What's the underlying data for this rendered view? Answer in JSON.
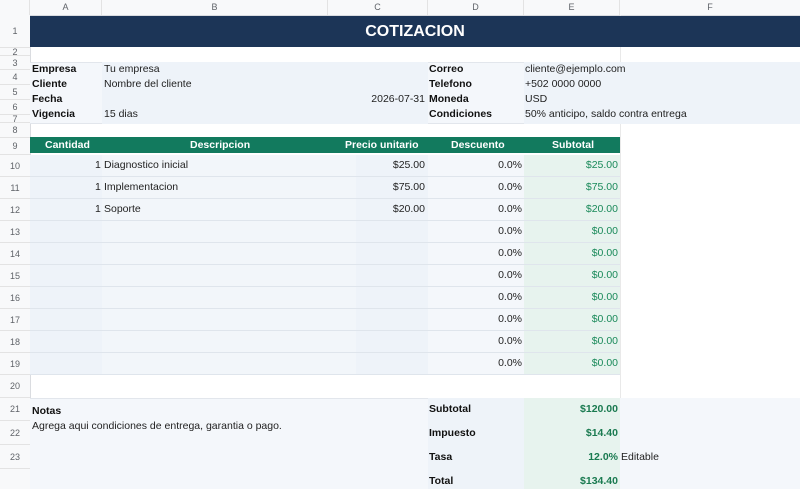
{
  "columns": [
    "A",
    "B",
    "C",
    "D",
    "E",
    "F"
  ],
  "rows": [
    "1",
    "2",
    "3",
    "4",
    "5",
    "6",
    "7",
    "8",
    "9",
    "10",
    "11",
    "12",
    "13",
    "14",
    "15",
    "16",
    "17",
    "18",
    "19",
    "20",
    "21",
    "22",
    "23"
  ],
  "title": "COTIZACION",
  "info_left": [
    {
      "label": "Empresa",
      "value": "Tu empresa"
    },
    {
      "label": "Cliente",
      "value": "Nombre del cliente"
    },
    {
      "label": "Fecha",
      "value": "",
      "extra": "2026-07-31"
    },
    {
      "label": "Vigencia",
      "value": "15 dias"
    }
  ],
  "info_right": [
    {
      "label": "Correo",
      "value": "cliente@ejemplo.com"
    },
    {
      "label": "Telefono",
      "value": "+502 0000 0000"
    },
    {
      "label": "Moneda",
      "value": "USD"
    },
    {
      "label": "Condiciones",
      "value": "50% anticipo, saldo contra entrega"
    }
  ],
  "table_headers": [
    "Cantidad",
    "Descripcion",
    "Precio unitario",
    "Descuento",
    "Subtotal"
  ],
  "items": [
    {
      "qty": "1",
      "desc": "Diagnostico inicial",
      "price": "$25.00",
      "disc": "0.0%",
      "subtotal": "$25.00"
    },
    {
      "qty": "1",
      "desc": "Implementacion",
      "price": "$75.00",
      "disc": "0.0%",
      "subtotal": "$75.00"
    },
    {
      "qty": "1",
      "desc": "Soporte",
      "price": "$20.00",
      "disc": "0.0%",
      "subtotal": "$20.00"
    },
    {
      "qty": "",
      "desc": "",
      "price": "",
      "disc": "0.0%",
      "subtotal": "$0.00"
    },
    {
      "qty": "",
      "desc": "",
      "price": "",
      "disc": "0.0%",
      "subtotal": "$0.00"
    },
    {
      "qty": "",
      "desc": "",
      "price": "",
      "disc": "0.0%",
      "subtotal": "$0.00"
    },
    {
      "qty": "",
      "desc": "",
      "price": "",
      "disc": "0.0%",
      "subtotal": "$0.00"
    },
    {
      "qty": "",
      "desc": "",
      "price": "",
      "disc": "0.0%",
      "subtotal": "$0.00"
    },
    {
      "qty": "",
      "desc": "",
      "price": "",
      "disc": "0.0%",
      "subtotal": "$0.00"
    },
    {
      "qty": "",
      "desc": "",
      "price": "",
      "disc": "0.0%",
      "subtotal": "$0.00"
    }
  ],
  "notes": {
    "label": "Notas",
    "text": "Agrega aqui condiciones de entrega, garantia o pago."
  },
  "totals": [
    {
      "label": "Subtotal",
      "value": "$120.00",
      "note": ""
    },
    {
      "label": "Impuesto",
      "value": "$14.40",
      "note": ""
    },
    {
      "label": "Tasa",
      "value": "12.0%",
      "note": "Editable"
    },
    {
      "label": "Total",
      "value": "$134.40",
      "note": ""
    }
  ],
  "colors": {
    "title_bg": "#1c3557",
    "header_bg": "#127a5e",
    "money": "#1a8a5a"
  }
}
